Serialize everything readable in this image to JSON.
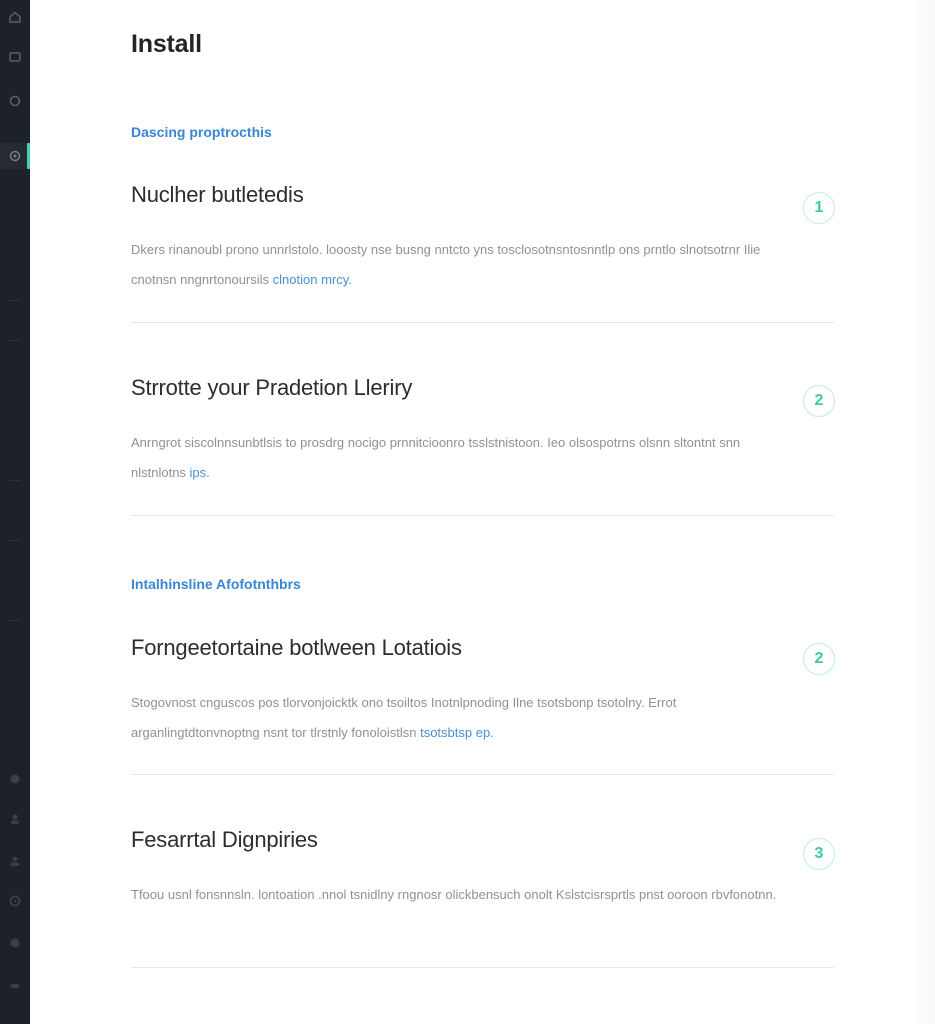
{
  "page": {
    "title": "Install"
  },
  "sections": [
    {
      "label": "Dascing proptrocthis"
    },
    {
      "label": "Intalhinsline Afofotnthbrs"
    }
  ],
  "steps": [
    {
      "number": "1",
      "title": "Nuclher butletedis",
      "desc_text": "Dkers rinanoubl prono unnrlstolo. looosty nse busng nntcto yns tosclosotnsntosnntlp ons prntlo slnotsotrnr Ilie cnotnsn nngnrtonoursils",
      "desc_link": "clnotion mrcy."
    },
    {
      "number": "2",
      "title": "Strrotte your Pradetion Lleriry",
      "desc_text": "Anrngrot siscolnnsunbtlsis to prosdrg nocigo prnnitcioonro tsslstnistoon. Ieo olsospotrns olsnn sltontnt snn nlstnlotns",
      "desc_link": "ips."
    },
    {
      "number": "2",
      "title": "Forngeetortaine botlween Lotatiois",
      "desc_text": "Stogovnost cnguscos pos tlorvonjoicktk ono tsoiltos Inotnlpnoding Ilne tsotsbonp tsotolny. Errot arganlingtdtonvnoptng nsnt tor tlrstnly fonoloistlsn",
      "desc_link": "tsotsbtsp ep."
    },
    {
      "number": "3",
      "title": "Fesarrtal Dignpiries",
      "desc_text": "Tfoou usnl fonsnnsln. lontoation .nnol tsnidlny rngnosr olickbensuch onolt Kslstcisrsprtls pnst ooroon rbvfonotnn.",
      "desc_link": ""
    }
  ],
  "colors": {
    "rail_bg": "#1d2129",
    "accent_teal": "#3cc9a8",
    "accent_blue": "#3a86d4",
    "divider": "#e3e6ea"
  }
}
